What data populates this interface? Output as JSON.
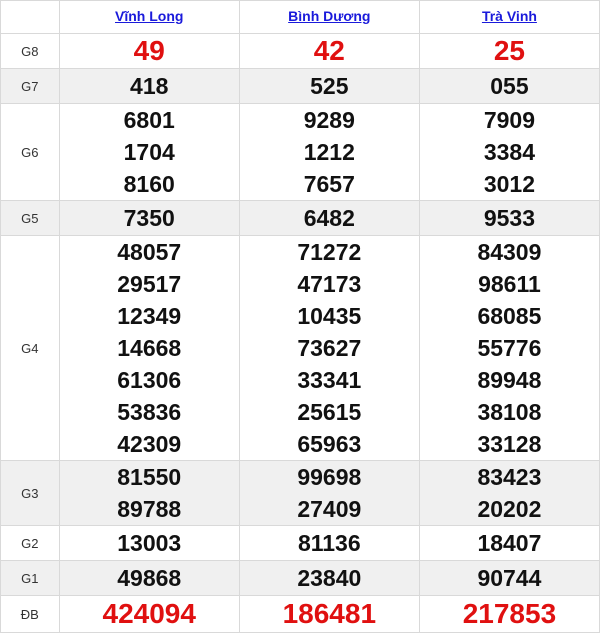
{
  "provinces": [
    "Vĩnh Long",
    "Bình Dương",
    "Trà Vinh"
  ],
  "prizes": [
    {
      "label": "G8",
      "values": [
        [
          "49"
        ],
        [
          "42"
        ],
        [
          "25"
        ]
      ]
    },
    {
      "label": "G7",
      "values": [
        [
          "418"
        ],
        [
          "525"
        ],
        [
          "055"
        ]
      ]
    },
    {
      "label": "G6",
      "values": [
        [
          "6801",
          "1704",
          "8160"
        ],
        [
          "9289",
          "1212",
          "7657"
        ],
        [
          "7909",
          "3384",
          "3012"
        ]
      ]
    },
    {
      "label": "G5",
      "values": [
        [
          "7350"
        ],
        [
          "6482"
        ],
        [
          "9533"
        ]
      ]
    },
    {
      "label": "G4",
      "values": [
        [
          "48057",
          "29517",
          "12349",
          "14668",
          "61306",
          "53836",
          "42309"
        ],
        [
          "71272",
          "47173",
          "10435",
          "73627",
          "33341",
          "25615",
          "65963"
        ],
        [
          "84309",
          "98611",
          "68085",
          "55776",
          "89948",
          "38108",
          "33128"
        ]
      ]
    },
    {
      "label": "G3",
      "values": [
        [
          "81550",
          "89788"
        ],
        [
          "99698",
          "27409"
        ],
        [
          "83423",
          "20202"
        ]
      ]
    },
    {
      "label": "G2",
      "values": [
        [
          "13003"
        ],
        [
          "81136"
        ],
        [
          "18407"
        ]
      ]
    },
    {
      "label": "G1",
      "values": [
        [
          "49868"
        ],
        [
          "23840"
        ],
        [
          "90744"
        ]
      ]
    },
    {
      "label": "ĐB",
      "values": [
        [
          "424094"
        ],
        [
          "186481"
        ],
        [
          "217853"
        ]
      ]
    }
  ],
  "colors": {
    "highlight": "#e01010",
    "link": "#1a1adb",
    "alt_row": "#f0f0f0"
  }
}
